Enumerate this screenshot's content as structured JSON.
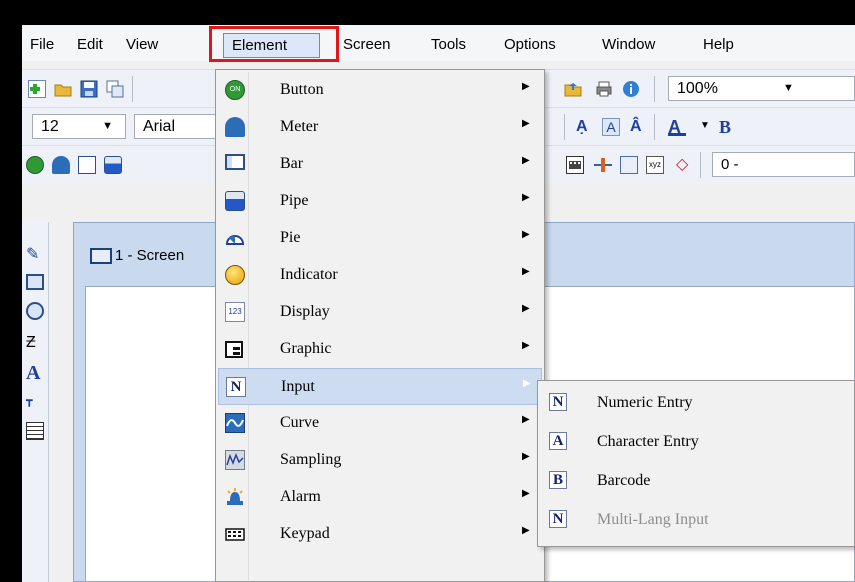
{
  "menubar": {
    "items": [
      "File",
      "Edit",
      "View",
      "Element",
      "Screen",
      "Tools",
      "Options",
      "Window",
      "Help"
    ],
    "open_item": "Element"
  },
  "toolbar1": {
    "zoom": "100%"
  },
  "toolbar2": {
    "font_size": "12",
    "font_name": "Arial"
  },
  "toolbar3": {
    "value_box": "0 -"
  },
  "child_window": {
    "title": "1 - Screen"
  },
  "element_menu": {
    "items": [
      {
        "label": "Button",
        "icon": "button-on-icon",
        "has_submenu": true
      },
      {
        "label": "Meter",
        "icon": "meter-icon",
        "has_submenu": true
      },
      {
        "label": "Bar",
        "icon": "bar-icon",
        "has_submenu": true
      },
      {
        "label": "Pipe",
        "icon": "pipe-icon",
        "has_submenu": true
      },
      {
        "label": "Pie",
        "icon": "pie-icon",
        "has_submenu": true
      },
      {
        "label": "Indicator",
        "icon": "indicator-icon",
        "has_submenu": true
      },
      {
        "label": "Display",
        "icon": "display-123-icon",
        "has_submenu": true
      },
      {
        "label": "Graphic",
        "icon": "graphic-icon",
        "has_submenu": true
      },
      {
        "label": "Input",
        "icon": "input-n-icon",
        "has_submenu": true,
        "highlighted": true
      },
      {
        "label": "Curve",
        "icon": "curve-icon",
        "has_submenu": true
      },
      {
        "label": "Sampling",
        "icon": "sampling-icon",
        "has_submenu": true
      },
      {
        "label": "Alarm",
        "icon": "alarm-icon",
        "has_submenu": true
      },
      {
        "label": "Keypad",
        "icon": "keypad-icon",
        "has_submenu": true
      }
    ]
  },
  "input_submenu": {
    "items": [
      {
        "label": "Numeric Entry",
        "glyph": "N",
        "enabled": true
      },
      {
        "label": "Character Entry",
        "glyph": "A",
        "enabled": true
      },
      {
        "label": "Barcode",
        "glyph": "B",
        "enabled": true
      },
      {
        "label": "Multi-Lang Input",
        "glyph": "N",
        "enabled": false
      }
    ]
  },
  "colors": {
    "highlight_box": "#e0161b",
    "menu_hover": "#cddcf1",
    "disabled_text": "#8d8d8d"
  }
}
